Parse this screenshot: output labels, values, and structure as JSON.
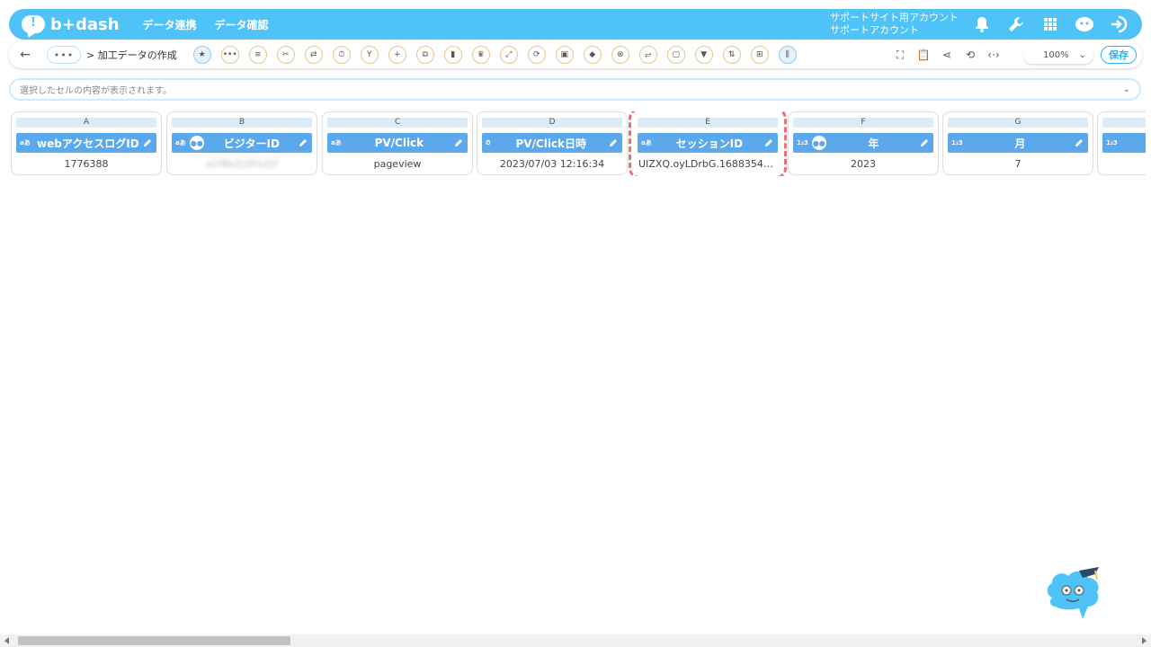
{
  "app": {
    "logo_text": "b+dash",
    "logo_mark": "!"
  },
  "nav": [
    {
      "label": "データ連携"
    },
    {
      "label": "データ確認"
    }
  ],
  "account": {
    "line1": "サポートサイト用アカウント",
    "line2": "サポートアカウント"
  },
  "header_icons": [
    "bell-icon",
    "wrench-icon",
    "grid-icon",
    "mascot-icon",
    "logout-icon"
  ],
  "toolbar": {
    "back_symbol": "←",
    "more_symbol": "•••",
    "breadcrumb": "> 加工データの作成",
    "zoom": "100%",
    "save_label": "保存"
  },
  "cellbar": {
    "placeholder": "選択したセルの内容が表示されます。"
  },
  "columns": [
    {
      "letter": "A",
      "type": "aあ",
      "name": "webアクセスログID",
      "value": "1776388",
      "people": false
    },
    {
      "letter": "B",
      "type": "aあ",
      "name": "ビジターID",
      "value": "a1f8b2c0f1d2f",
      "people": true,
      "blurred": true
    },
    {
      "letter": "C",
      "type": "aあ",
      "name": "PV/Click",
      "value": "pageview",
      "people": false
    },
    {
      "letter": "D",
      "type": "⏱",
      "name": "PV/Click日時",
      "value": "2023/07/03 12:16:34",
      "people": false
    },
    {
      "letter": "E",
      "type": "aあ",
      "name": "セッションID",
      "value": "UIZXQ.oyLDrbG.1688354194...",
      "people": false,
      "selected": true
    },
    {
      "letter": "F",
      "type": "1₂3",
      "name": "年",
      "value": "2023",
      "people": true
    },
    {
      "letter": "G",
      "type": "1₂3",
      "name": "月",
      "value": "7",
      "people": false
    },
    {
      "letter": "",
      "type": "1₂3",
      "name": "",
      "value": "",
      "people": false
    }
  ],
  "colors": {
    "header": "#4fc3f7",
    "column_header": "#5ba8ec",
    "selection": "#ee6b78"
  }
}
